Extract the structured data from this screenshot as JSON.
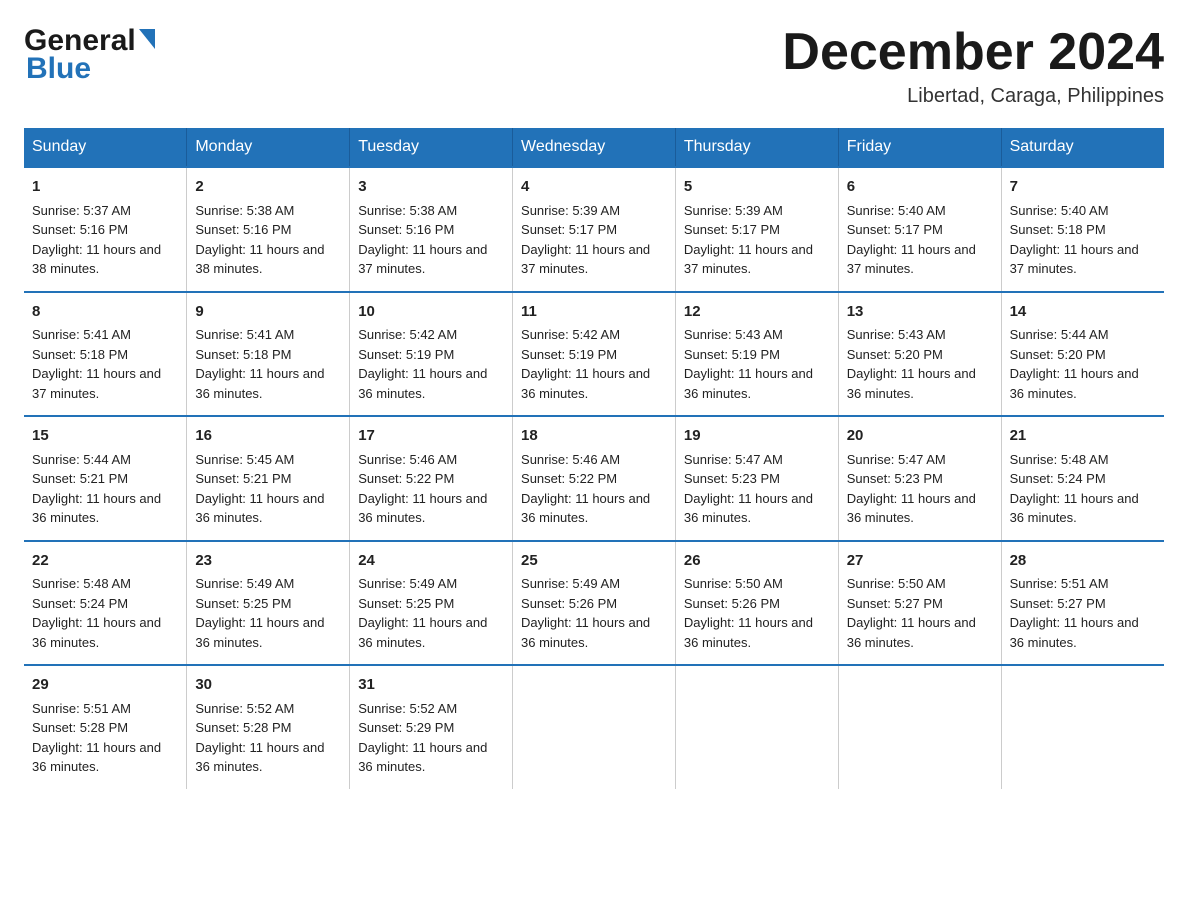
{
  "logo": {
    "general": "General",
    "blue": "Blue",
    "arrow": true
  },
  "title": "December 2024",
  "subtitle": "Libertad, Caraga, Philippines",
  "weekdays": [
    "Sunday",
    "Monday",
    "Tuesday",
    "Wednesday",
    "Thursday",
    "Friday",
    "Saturday"
  ],
  "weeks": [
    [
      {
        "day": "1",
        "sunrise": "5:37 AM",
        "sunset": "5:16 PM",
        "daylight": "11 hours and 38 minutes."
      },
      {
        "day": "2",
        "sunrise": "5:38 AM",
        "sunset": "5:16 PM",
        "daylight": "11 hours and 38 minutes."
      },
      {
        "day": "3",
        "sunrise": "5:38 AM",
        "sunset": "5:16 PM",
        "daylight": "11 hours and 37 minutes."
      },
      {
        "day": "4",
        "sunrise": "5:39 AM",
        "sunset": "5:17 PM",
        "daylight": "11 hours and 37 minutes."
      },
      {
        "day": "5",
        "sunrise": "5:39 AM",
        "sunset": "5:17 PM",
        "daylight": "11 hours and 37 minutes."
      },
      {
        "day": "6",
        "sunrise": "5:40 AM",
        "sunset": "5:17 PM",
        "daylight": "11 hours and 37 minutes."
      },
      {
        "day": "7",
        "sunrise": "5:40 AM",
        "sunset": "5:18 PM",
        "daylight": "11 hours and 37 minutes."
      }
    ],
    [
      {
        "day": "8",
        "sunrise": "5:41 AM",
        "sunset": "5:18 PM",
        "daylight": "11 hours and 37 minutes."
      },
      {
        "day": "9",
        "sunrise": "5:41 AM",
        "sunset": "5:18 PM",
        "daylight": "11 hours and 36 minutes."
      },
      {
        "day": "10",
        "sunrise": "5:42 AM",
        "sunset": "5:19 PM",
        "daylight": "11 hours and 36 minutes."
      },
      {
        "day": "11",
        "sunrise": "5:42 AM",
        "sunset": "5:19 PM",
        "daylight": "11 hours and 36 minutes."
      },
      {
        "day": "12",
        "sunrise": "5:43 AM",
        "sunset": "5:19 PM",
        "daylight": "11 hours and 36 minutes."
      },
      {
        "day": "13",
        "sunrise": "5:43 AM",
        "sunset": "5:20 PM",
        "daylight": "11 hours and 36 minutes."
      },
      {
        "day": "14",
        "sunrise": "5:44 AM",
        "sunset": "5:20 PM",
        "daylight": "11 hours and 36 minutes."
      }
    ],
    [
      {
        "day": "15",
        "sunrise": "5:44 AM",
        "sunset": "5:21 PM",
        "daylight": "11 hours and 36 minutes."
      },
      {
        "day": "16",
        "sunrise": "5:45 AM",
        "sunset": "5:21 PM",
        "daylight": "11 hours and 36 minutes."
      },
      {
        "day": "17",
        "sunrise": "5:46 AM",
        "sunset": "5:22 PM",
        "daylight": "11 hours and 36 minutes."
      },
      {
        "day": "18",
        "sunrise": "5:46 AM",
        "sunset": "5:22 PM",
        "daylight": "11 hours and 36 minutes."
      },
      {
        "day": "19",
        "sunrise": "5:47 AM",
        "sunset": "5:23 PM",
        "daylight": "11 hours and 36 minutes."
      },
      {
        "day": "20",
        "sunrise": "5:47 AM",
        "sunset": "5:23 PM",
        "daylight": "11 hours and 36 minutes."
      },
      {
        "day": "21",
        "sunrise": "5:48 AM",
        "sunset": "5:24 PM",
        "daylight": "11 hours and 36 minutes."
      }
    ],
    [
      {
        "day": "22",
        "sunrise": "5:48 AM",
        "sunset": "5:24 PM",
        "daylight": "11 hours and 36 minutes."
      },
      {
        "day": "23",
        "sunrise": "5:49 AM",
        "sunset": "5:25 PM",
        "daylight": "11 hours and 36 minutes."
      },
      {
        "day": "24",
        "sunrise": "5:49 AM",
        "sunset": "5:25 PM",
        "daylight": "11 hours and 36 minutes."
      },
      {
        "day": "25",
        "sunrise": "5:49 AM",
        "sunset": "5:26 PM",
        "daylight": "11 hours and 36 minutes."
      },
      {
        "day": "26",
        "sunrise": "5:50 AM",
        "sunset": "5:26 PM",
        "daylight": "11 hours and 36 minutes."
      },
      {
        "day": "27",
        "sunrise": "5:50 AM",
        "sunset": "5:27 PM",
        "daylight": "11 hours and 36 minutes."
      },
      {
        "day": "28",
        "sunrise": "5:51 AM",
        "sunset": "5:27 PM",
        "daylight": "11 hours and 36 minutes."
      }
    ],
    [
      {
        "day": "29",
        "sunrise": "5:51 AM",
        "sunset": "5:28 PM",
        "daylight": "11 hours and 36 minutes."
      },
      {
        "day": "30",
        "sunrise": "5:52 AM",
        "sunset": "5:28 PM",
        "daylight": "11 hours and 36 minutes."
      },
      {
        "day": "31",
        "sunrise": "5:52 AM",
        "sunset": "5:29 PM",
        "daylight": "11 hours and 36 minutes."
      },
      null,
      null,
      null,
      null
    ]
  ]
}
